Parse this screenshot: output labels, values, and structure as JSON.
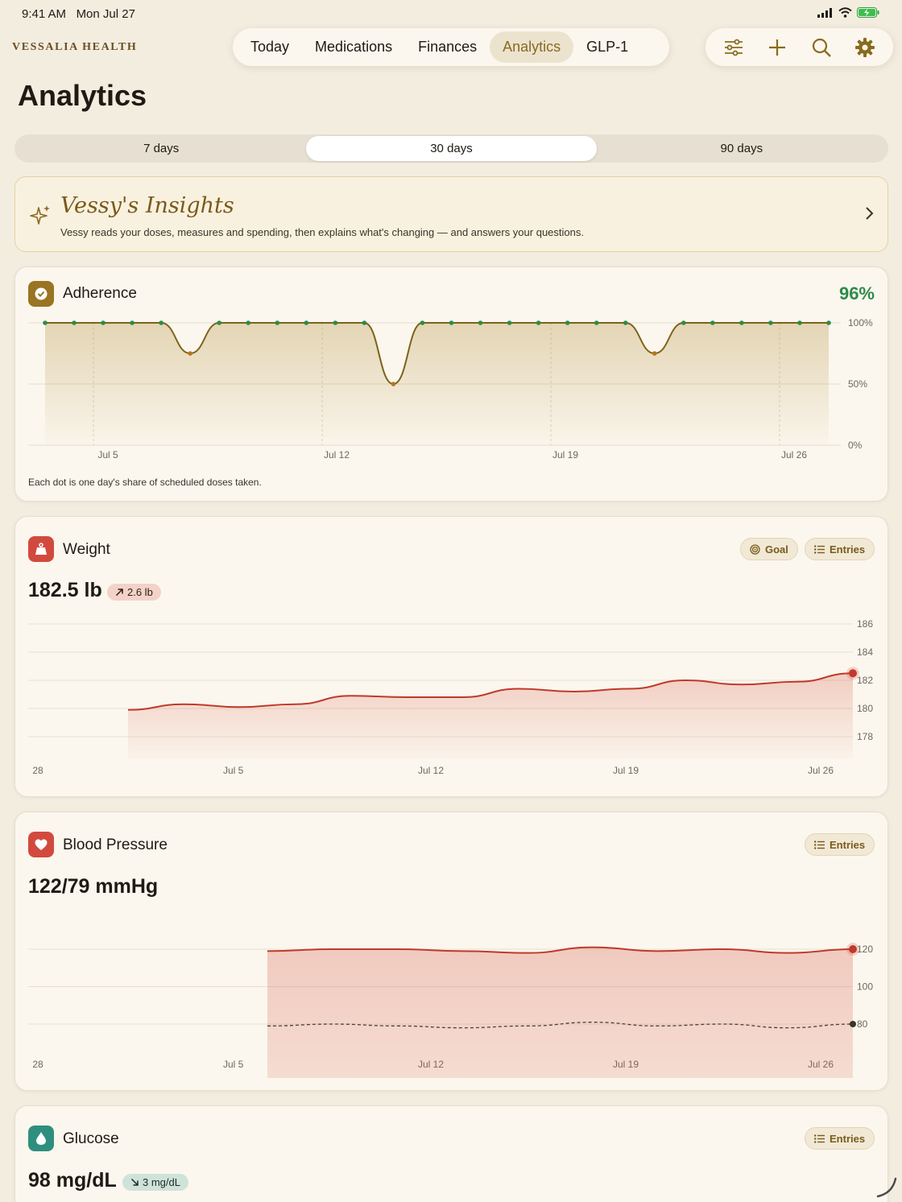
{
  "status": {
    "time": "9:41 AM",
    "date": "Mon Jul 27"
  },
  "brand": "VESSALIA HEALTH",
  "nav": {
    "tabs": [
      {
        "label": "Today",
        "active": false
      },
      {
        "label": "Medications",
        "active": false
      },
      {
        "label": "Finances",
        "active": false
      },
      {
        "label": "Analytics",
        "active": true
      },
      {
        "label": "GLP-1",
        "active": false
      }
    ]
  },
  "toolbar": {
    "icons": [
      "sliders-icon",
      "plus-icon",
      "search-icon",
      "gear-icon"
    ]
  },
  "page_title": "Analytics",
  "range": {
    "options": [
      "7 days",
      "30 days",
      "90 days"
    ],
    "selected": "30 days"
  },
  "insights": {
    "title": "Vessy's Insights",
    "subtitle": "Vessy reads your doses, measures and spending, then explains what's changing — and answers your questions."
  },
  "adherence": {
    "title": "Adherence",
    "value": "96%",
    "caption": "Each dot is one day's share of scheduled doses taken.",
    "accent": "#2e8b4a"
  },
  "weight": {
    "title": "Weight",
    "value": "182.5 lb",
    "delta": "2.6 lb",
    "goal_label": "Goal",
    "entries_label": "Entries"
  },
  "blood_pressure": {
    "title": "Blood Pressure",
    "value": "122/79 mmHg",
    "entries_label": "Entries"
  },
  "glucose": {
    "title": "Glucose",
    "value": "98 mg/dL",
    "delta": "3 mg/dL",
    "entries_label": "Entries"
  },
  "chart_data": [
    {
      "type": "line",
      "name": "adherence",
      "x": [
        "Jun 28",
        "Jun 29",
        "Jun 30",
        "Jul 1",
        "Jul 2",
        "Jul 3",
        "Jul 4",
        "Jul 5",
        "Jul 6",
        "Jul 7",
        "Jul 8",
        "Jul 9",
        "Jul 10",
        "Jul 11",
        "Jul 12",
        "Jul 13",
        "Jul 14",
        "Jul 15",
        "Jul 16",
        "Jul 17",
        "Jul 18",
        "Jul 19",
        "Jul 20",
        "Jul 21",
        "Jul 22",
        "Jul 23",
        "Jul 24",
        "Jul 25"
      ],
      "values": [
        100,
        100,
        100,
        100,
        100,
        75,
        100,
        100,
        100,
        100,
        100,
        100,
        50,
        100,
        100,
        100,
        100,
        100,
        100,
        100,
        100,
        75,
        100,
        100,
        100,
        100,
        100,
        100
      ],
      "xticks": [
        "Jul 5",
        "Jul 12",
        "Jul 19",
        "Jul 26"
      ],
      "yticks": [
        "100%",
        "50%",
        "0%"
      ],
      "ylim": [
        0,
        100
      ]
    },
    {
      "type": "area",
      "name": "weight",
      "x": [
        "Jul 2",
        "Jul 4",
        "Jul 6",
        "Jul 8",
        "Jul 10",
        "Jul 12",
        "Jul 14",
        "Jul 16",
        "Jul 18",
        "Jul 20",
        "Jul 22",
        "Jul 24",
        "Jul 26",
        "Jul 28"
      ],
      "values": [
        179.9,
        180.3,
        180.1,
        180.3,
        180.9,
        180.8,
        180.8,
        181.4,
        181.2,
        181.4,
        182.0,
        181.7,
        181.9,
        182.5
      ],
      "xticks": [
        "28",
        "Jul 5",
        "Jul 12",
        "Jul 19",
        "Jul 26"
      ],
      "yticks": [
        "186",
        "184",
        "182",
        "180",
        "178"
      ],
      "ylim": [
        177,
        187
      ]
    },
    {
      "type": "line",
      "name": "blood pressure",
      "x": [
        "Jul 9",
        "Jul 11",
        "Jul 13",
        "Jul 15",
        "Jul 17",
        "Jul 19",
        "Jul 21",
        "Jul 23",
        "Jul 25",
        "Jul 27"
      ],
      "series": [
        {
          "values": [
            119,
            120,
            120,
            119,
            118,
            121,
            119,
            120,
            118,
            120
          ]
        },
        {
          "values": [
            79,
            80,
            79,
            78,
            79,
            81,
            79,
            80,
            78,
            80
          ]
        }
      ],
      "xticks": [
        "28",
        "Jul 5",
        "Jul 12",
        "Jul 19",
        "Jul 26"
      ],
      "yticks": [
        "120",
        "100",
        "80"
      ],
      "ylim": [
        60,
        130
      ]
    }
  ]
}
